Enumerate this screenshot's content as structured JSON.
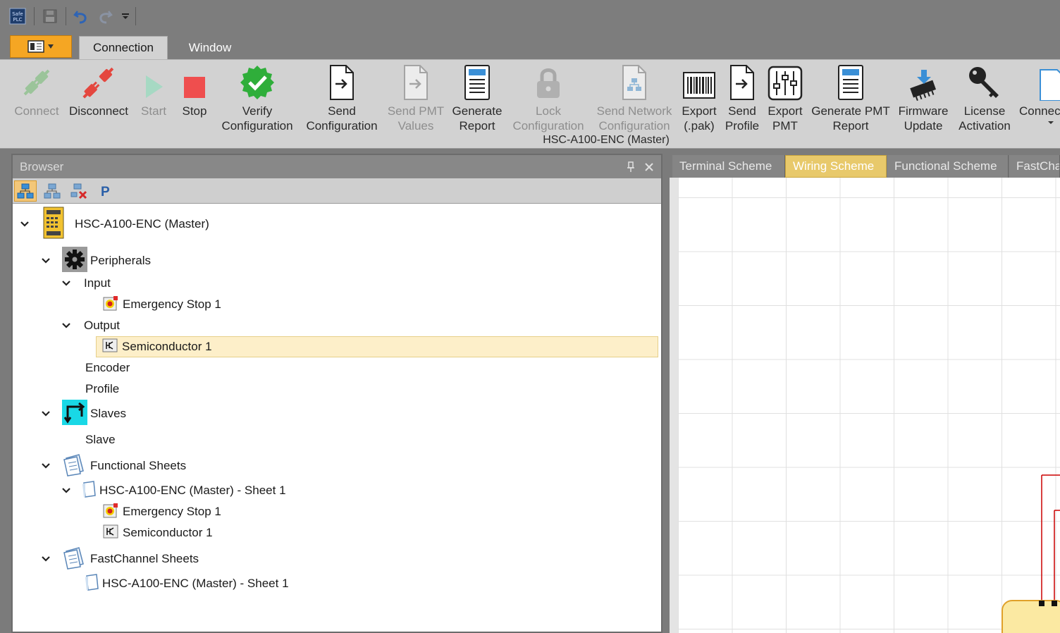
{
  "quick_access": {
    "app_icon": "safe-plc-logo-icon",
    "save_icon": "save-icon",
    "undo_icon": "undo-icon",
    "redo_icon": "redo-icon",
    "customize_icon": "dropdown-arrow-icon"
  },
  "ribbon_tabs": [
    {
      "label": "Connection",
      "active": true
    },
    {
      "label": "Window",
      "active": false
    }
  ],
  "ribbon_buttons": [
    {
      "label": "Connect",
      "icon": "plug-connect-icon",
      "enabled": false
    },
    {
      "label": "Disconnect",
      "icon": "plug-disconnect-icon",
      "enabled": true
    },
    {
      "label": "Start",
      "icon": "play-icon",
      "enabled": false
    },
    {
      "label": "Stop",
      "icon": "stop-icon",
      "enabled": true
    },
    {
      "label": "Verify\nConfiguration",
      "icon": "verify-checkmark-icon",
      "enabled": true
    },
    {
      "label": "Send\nConfiguration",
      "icon": "send-document-icon",
      "enabled": true
    },
    {
      "label": "Send PMT\nValues",
      "icon": "send-document-icon",
      "enabled": false
    },
    {
      "label": "Generate\nReport",
      "icon": "report-icon",
      "enabled": true
    },
    {
      "label": "Lock\nConfiguration",
      "icon": "lock-icon",
      "enabled": false
    },
    {
      "label": "Send Network\nConfiguration",
      "icon": "network-document-icon",
      "enabled": false
    },
    {
      "label": "Export\n(.pak)",
      "icon": "barcode-icon",
      "enabled": true
    },
    {
      "label": "Send\nProfile",
      "icon": "send-document-icon",
      "enabled": true
    },
    {
      "label": "Export\nPMT",
      "icon": "sliders-icon",
      "enabled": true
    },
    {
      "label": "Generate PMT\nReport",
      "icon": "report-icon",
      "enabled": true
    },
    {
      "label": "Firmware\nUpdate",
      "icon": "chip-download-icon",
      "enabled": true
    },
    {
      "label": "License\nActivation",
      "icon": "key-icon",
      "enabled": true
    },
    {
      "label": "Connec",
      "icon": "document-icon",
      "enabled": true
    }
  ],
  "ribbon_group_label": "HSC-A100-ENC (Master)",
  "browser": {
    "title": "Browser",
    "pin_icon": "pin-icon",
    "close_icon": "close-icon",
    "toolbar": [
      {
        "icon": "tree-view-icon",
        "active": true
      },
      {
        "icon": "network-view-icon",
        "active": false
      },
      {
        "icon": "network-remove-icon",
        "active": false
      },
      {
        "icon": "parameter-p-icon",
        "active": false
      }
    ],
    "tree": [
      {
        "label": "HSC-A100-ENC (Master)",
        "icon": "plc-device-icon",
        "expanded": true
      },
      {
        "label": "Peripherals",
        "icon": "gear-icon",
        "expanded": true
      },
      {
        "label": "Input",
        "expanded": true
      },
      {
        "label": "Emergency Stop 1",
        "icon": "emergency-stop-icon"
      },
      {
        "label": "Output",
        "expanded": true
      },
      {
        "label": "Semiconductor 1",
        "icon": "semiconductor-icon",
        "selected": true
      },
      {
        "label": "Encoder"
      },
      {
        "label": "Profile"
      },
      {
        "label": "Slaves",
        "icon": "slaves-arrows-icon",
        "expanded": true
      },
      {
        "label": "Slave"
      },
      {
        "label": "Functional Sheets",
        "icon": "sheets-icon",
        "expanded": true
      },
      {
        "label": "HSC-A100-ENC (Master) - Sheet 1",
        "icon": "sheet-icon",
        "expanded": true
      },
      {
        "label": "Emergency Stop 1",
        "icon": "emergency-stop-icon"
      },
      {
        "label": "Semiconductor 1",
        "icon": "semiconductor-icon"
      },
      {
        "label": "FastChannel Sheets",
        "icon": "sheets-icon",
        "expanded": true
      },
      {
        "label": "HSC-A100-ENC (Master) - Sheet 1",
        "icon": "sheet-icon"
      }
    ]
  },
  "document_tabs": [
    {
      "label": "Terminal Scheme",
      "active": false
    },
    {
      "label": "Wiring Scheme",
      "active": true
    },
    {
      "label": "Functional Scheme",
      "active": false
    },
    {
      "label": "FastCha",
      "active": false
    }
  ],
  "colors": {
    "app_menu": "#f5a623",
    "selection": "#fdefc9",
    "active_doc_tab": "#e8c96b",
    "wire": "#cc0000"
  }
}
